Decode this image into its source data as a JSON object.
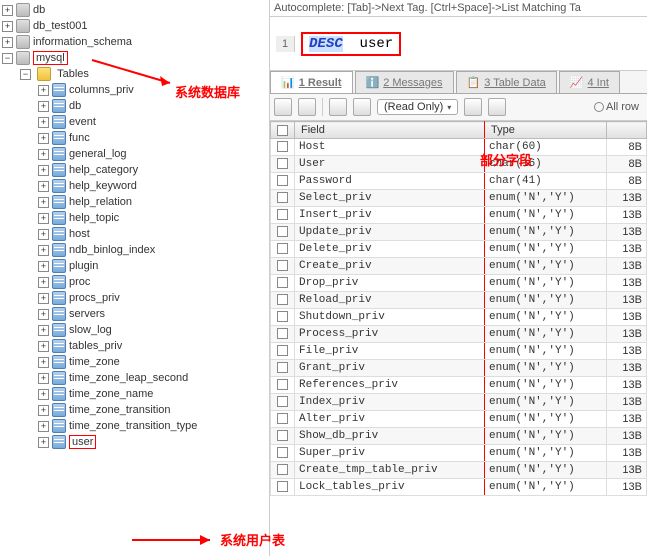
{
  "tree": {
    "root": [
      {
        "label": "db"
      },
      {
        "label": "db_test001"
      },
      {
        "label": "information_schema"
      },
      {
        "label": "mysql",
        "selected": true
      }
    ],
    "tables_label": "Tables",
    "tables": [
      "columns_priv",
      "db",
      "event",
      "func",
      "general_log",
      "help_category",
      "help_keyword",
      "help_relation",
      "help_topic",
      "host",
      "ndb_binlog_index",
      "plugin",
      "proc",
      "procs_priv",
      "servers",
      "slow_log",
      "tables_priv",
      "time_zone",
      "time_zone_leap_second",
      "time_zone_name",
      "time_zone_transition",
      "time_zone_transition_type",
      "user"
    ]
  },
  "editor": {
    "autocomplete_hint": "Autocomplete: [Tab]->Next Tag. [Ctrl+Space]->List Matching Ta",
    "line": "1",
    "keyword": "DESC",
    "ident": "user"
  },
  "tabs": {
    "result": {
      "num": "1",
      "label": "1 Result"
    },
    "messages": {
      "num": "2",
      "label": "2 Messages"
    },
    "tabledata": {
      "num": "3",
      "label": "3 Table Data"
    },
    "info": {
      "num": "4",
      "label": "4 Int"
    }
  },
  "toolbar": {
    "readonly_label": "(Read Only)",
    "allrow_label": "All row"
  },
  "grid": {
    "headers": {
      "field": "Field",
      "type": "Type",
      "size": ""
    },
    "rows": [
      {
        "field": "Host",
        "type": "char(60)",
        "size": "8B"
      },
      {
        "field": "User",
        "type": "char(16)",
        "size": "8B"
      },
      {
        "field": "Password",
        "type": "char(41)",
        "size": "8B"
      },
      {
        "field": "Select_priv",
        "type": "enum('N','Y')",
        "size": "13B"
      },
      {
        "field": "Insert_priv",
        "type": "enum('N','Y')",
        "size": "13B"
      },
      {
        "field": "Update_priv",
        "type": "enum('N','Y')",
        "size": "13B"
      },
      {
        "field": "Delete_priv",
        "type": "enum('N','Y')",
        "size": "13B"
      },
      {
        "field": "Create_priv",
        "type": "enum('N','Y')",
        "size": "13B"
      },
      {
        "field": "Drop_priv",
        "type": "enum('N','Y')",
        "size": "13B"
      },
      {
        "field": "Reload_priv",
        "type": "enum('N','Y')",
        "size": "13B"
      },
      {
        "field": "Shutdown_priv",
        "type": "enum('N','Y')",
        "size": "13B"
      },
      {
        "field": "Process_priv",
        "type": "enum('N','Y')",
        "size": "13B"
      },
      {
        "field": "File_priv",
        "type": "enum('N','Y')",
        "size": "13B"
      },
      {
        "field": "Grant_priv",
        "type": "enum('N','Y')",
        "size": "13B"
      },
      {
        "field": "References_priv",
        "type": "enum('N','Y')",
        "size": "13B"
      },
      {
        "field": "Index_priv",
        "type": "enum('N','Y')",
        "size": "13B"
      },
      {
        "field": "Alter_priv",
        "type": "enum('N','Y')",
        "size": "13B"
      },
      {
        "field": "Show_db_priv",
        "type": "enum('N','Y')",
        "size": "13B"
      },
      {
        "field": "Super_priv",
        "type": "enum('N','Y')",
        "size": "13B"
      },
      {
        "field": "Create_tmp_table_priv",
        "type": "enum('N','Y')",
        "size": "13B"
      },
      {
        "field": "Lock_tables_priv",
        "type": "enum('N','Y')",
        "size": "13B"
      }
    ]
  },
  "annotations": {
    "systemdb": "系统数据库",
    "partialfields": "部分字段",
    "usertable": "系统用户表"
  }
}
